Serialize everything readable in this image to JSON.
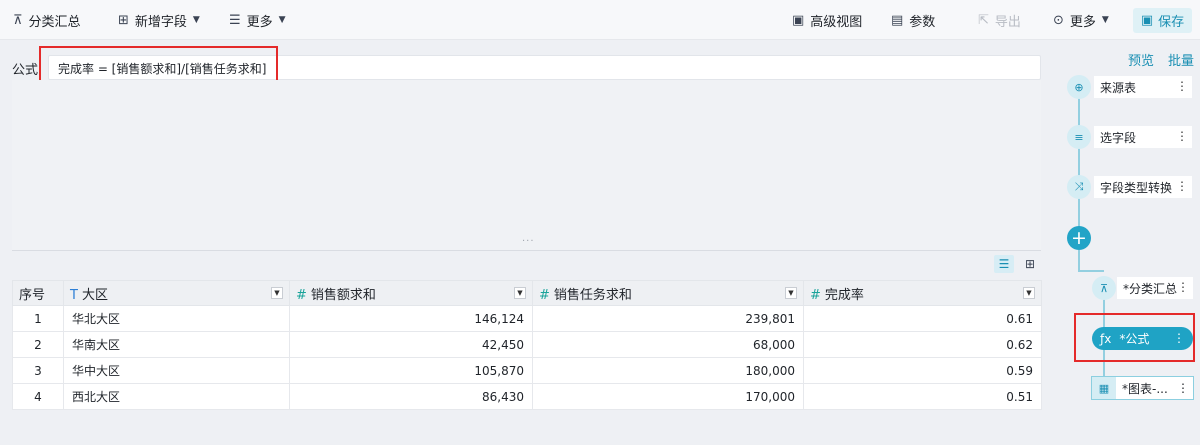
{
  "toolbar": {
    "group_summary": "分类汇总",
    "new_field": "新增字段",
    "more_left": "更多",
    "advanced_view": "高级视图",
    "params": "参数",
    "export": "导出",
    "more_right": "更多",
    "save": "保存"
  },
  "formula": {
    "label": "公式",
    "value": "完成率 = [销售额求和]/[销售任务求和]"
  },
  "table": {
    "columns": [
      {
        "label": "序号",
        "type": "index"
      },
      {
        "label": "大区",
        "type": "text"
      },
      {
        "label": "销售额求和",
        "type": "number"
      },
      {
        "label": "销售任务求和",
        "type": "number"
      },
      {
        "label": "完成率",
        "type": "number"
      }
    ],
    "rows": [
      [
        "1",
        "华北大区",
        "146,124",
        "239,801",
        "0.61"
      ],
      [
        "2",
        "华南大区",
        "42,450",
        "68,000",
        "0.62"
      ],
      [
        "3",
        "华中大区",
        "105,870",
        "180,000",
        "0.59"
      ],
      [
        "4",
        "西北大区",
        "86,430",
        "170,000",
        "0.51"
      ]
    ]
  },
  "sidebar": {
    "preview": "预览",
    "batch": "批量",
    "nodes": [
      {
        "label": "来源表",
        "icon": "target-icon"
      },
      {
        "label": "选字段",
        "icon": "select-fields-icon"
      },
      {
        "label": "字段类型转换",
        "icon": "shuffle-icon"
      },
      {
        "label": "*分类汇总",
        "icon": "hierarchy-icon"
      },
      {
        "label": "*公式",
        "icon": "function-icon"
      },
      {
        "label": "*图表-...",
        "icon": "table-icon"
      }
    ]
  },
  "colors": {
    "accent": "#1fa3c5",
    "highlight_border": "#e42a2a"
  }
}
